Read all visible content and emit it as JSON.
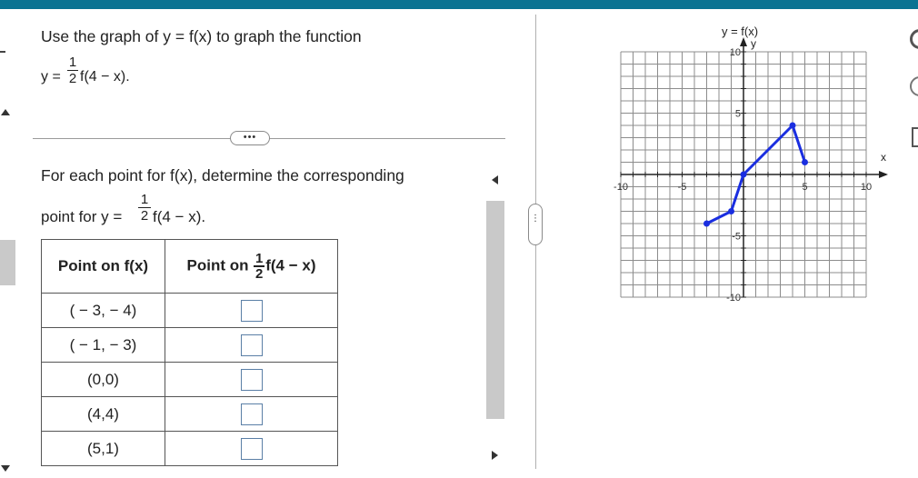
{
  "colors": {
    "top_bar": "#0a7392",
    "line": "#1a2ee0",
    "grid": "#8c8c8c",
    "input_border": "#5a7fa6"
  },
  "question": {
    "line1": "Use the graph of y = f(x) to graph the function",
    "func_prefix": "y = ",
    "func_num": "1",
    "func_den": "2",
    "func_suffix": "f(4 − x)."
  },
  "more_button": "•••",
  "instruction": {
    "line1": "For each point for f(x), determine the corresponding",
    "line2_prefix": "point for y = ",
    "num": "1",
    "den": "2",
    "suffix": "f(4 − x)."
  },
  "table": {
    "col1_header": "Point on f(x)",
    "col2_header_prefix": "Point on ",
    "col2_num": "1",
    "col2_den": "2",
    "col2_suffix": "f(4 − x)",
    "rows": [
      {
        "point": "( − 3, − 4)",
        "answer": ""
      },
      {
        "point": "( − 1, − 3)",
        "answer": ""
      },
      {
        "point": "(0,0)",
        "answer": ""
      },
      {
        "point": "(4,4)",
        "answer": ""
      },
      {
        "point": "(5,1)",
        "answer": ""
      }
    ]
  },
  "panel_handle": "⋮",
  "chart_data": {
    "type": "line",
    "title": "y = f(x)",
    "xlabel": "x",
    "ylabel": "y",
    "xlim": [
      -10,
      10
    ],
    "ylim": [
      -10,
      10
    ],
    "grid": true,
    "x_tick_labels": [
      "-10",
      "-5",
      "5",
      "10"
    ],
    "y_tick_labels": [
      "10",
      "5",
      "-5",
      "-10"
    ],
    "series": [
      {
        "points": [
          [
            -3,
            -4
          ],
          [
            -1,
            -3
          ],
          [
            0,
            0
          ],
          [
            4,
            4
          ],
          [
            5,
            1
          ]
        ]
      }
    ]
  }
}
